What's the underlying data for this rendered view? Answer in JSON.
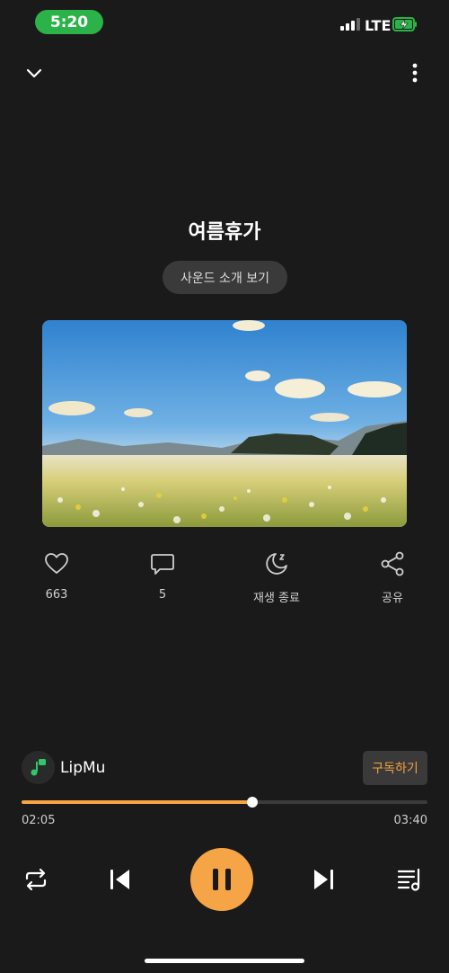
{
  "status": {
    "time": "5:20",
    "network": "LTE"
  },
  "track": {
    "title": "여름휴가",
    "intro_label": "사운드 소개 보기"
  },
  "actions": {
    "like_count": "663",
    "comment_count": "5",
    "sleep_label": "재생 종료",
    "share_label": "공유"
  },
  "artist": {
    "name": "LipMu",
    "subscribe_label": "구독하기"
  },
  "progress": {
    "elapsed": "02:05",
    "total": "03:40",
    "fraction": 0.568
  },
  "colors": {
    "accent": "#f5a545",
    "background": "#1a1a1a",
    "status_pill": "#2bb34a"
  },
  "icons": [
    "chevron-down-icon",
    "more-vertical-icon",
    "heart-icon",
    "comment-icon",
    "moon-sleep-icon",
    "share-icon",
    "repeat-icon",
    "previous-icon",
    "pause-icon",
    "next-icon",
    "playlist-icon"
  ]
}
